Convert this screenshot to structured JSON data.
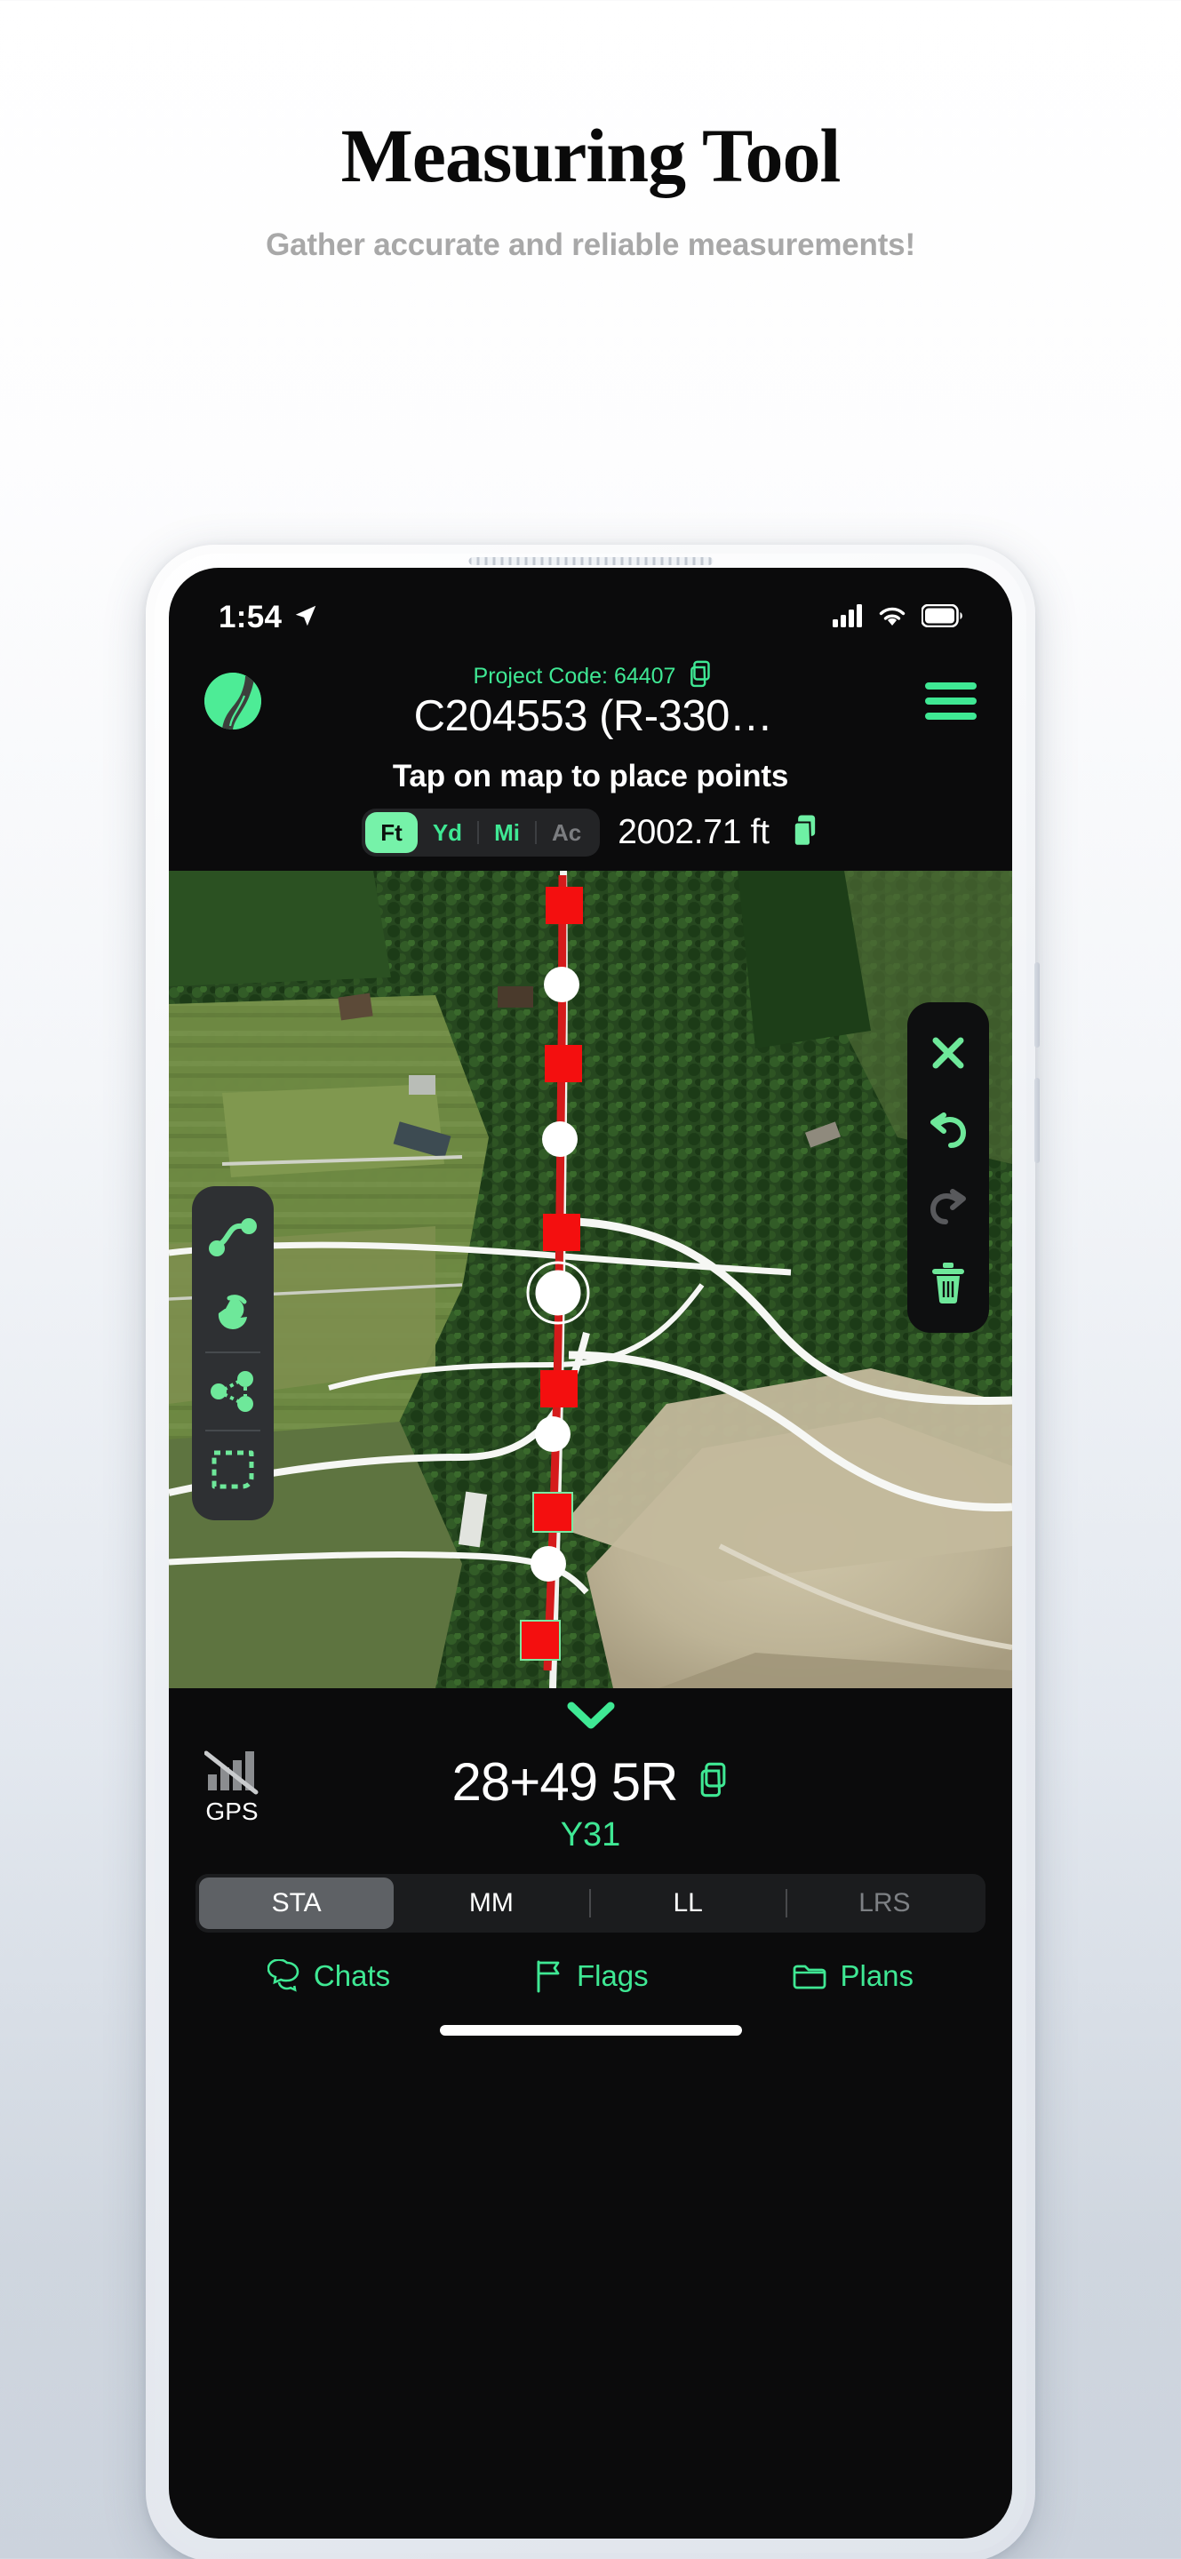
{
  "promo": {
    "headline": "Measuring Tool",
    "subheadline": "Gather accurate and reliable measurements!"
  },
  "status_bar": {
    "time": "1:54",
    "location_icon": "location-arrow-icon",
    "cellular_icon": "cellular-bars-icon",
    "wifi_icon": "wifi-icon",
    "battery_icon": "battery-full-icon"
  },
  "app_header": {
    "logo_icon": "road-logo-icon",
    "project_code_label": "Project Code: 64407",
    "project_code_copy_icon": "copy-icon",
    "title": "C204553 (R-330…",
    "menu_icon": "hamburger-menu-icon"
  },
  "toolbar": {
    "instruction": "Tap on map to place points",
    "units": [
      {
        "label": "Ft",
        "state": "active"
      },
      {
        "label": "Yd",
        "state": "enabled"
      },
      {
        "label": "Mi",
        "state": "enabled"
      },
      {
        "label": "Ac",
        "state": "disabled"
      }
    ],
    "measurement": "2002.71 ft",
    "measurement_copy_icon": "copy-icon"
  },
  "map": {
    "left_tools": [
      {
        "name": "draw-path-tool",
        "icon": "polyline-path-icon"
      },
      {
        "name": "pan-hand-tool",
        "icon": "hand-pointer-icon"
      },
      {
        "name": "node-select-tool",
        "icon": "share-nodes-icon"
      },
      {
        "name": "area-select-tool",
        "icon": "dashed-rectangle-icon"
      }
    ],
    "right_tools": [
      {
        "name": "close-measure-button",
        "icon": "close-x-icon",
        "state": "enabled"
      },
      {
        "name": "undo-button",
        "icon": "undo-arrow-icon",
        "state": "enabled"
      },
      {
        "name": "redo-button",
        "icon": "redo-arrow-icon",
        "state": "disabled"
      },
      {
        "name": "delete-button",
        "icon": "trash-icon",
        "state": "enabled"
      }
    ],
    "line_color": "#d51b1b",
    "vertex_color": "#f40f0f",
    "midpoint_color": "#ffffff"
  },
  "bottom_panel": {
    "collapse_icon": "chevron-down-icon",
    "gps_icon": "gps-no-signal-icon",
    "gps_label": "GPS",
    "station": "28+49 5R",
    "station_copy_icon": "copy-icon",
    "route_label": "Y31",
    "tabs": [
      {
        "label": "STA",
        "state": "active"
      },
      {
        "label": "MM",
        "state": "enabled"
      },
      {
        "label": "LL",
        "state": "enabled"
      },
      {
        "label": "LRS",
        "state": "disabled"
      }
    ],
    "nav": [
      {
        "label": "Chats",
        "icon": "chat-bubbles-icon"
      },
      {
        "label": "Flags",
        "icon": "flag-icon"
      },
      {
        "label": "Plans",
        "icon": "folder-icon"
      }
    ]
  },
  "colors": {
    "accent_green": "#3fe894",
    "accent_green_bright": "#76f2a9",
    "screen_bg": "#0b0b0c",
    "marker_red": "#f40f0f"
  }
}
